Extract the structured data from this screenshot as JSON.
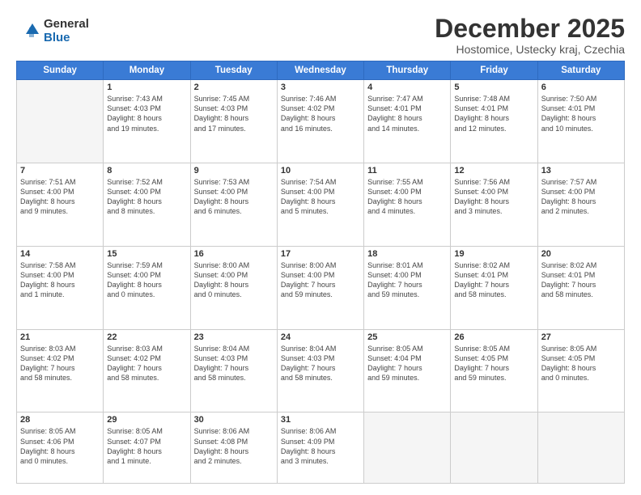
{
  "logo": {
    "general": "General",
    "blue": "Blue"
  },
  "header": {
    "month": "December 2025",
    "location": "Hostomice, Ustecky kraj, Czechia"
  },
  "weekdays": [
    "Sunday",
    "Monday",
    "Tuesday",
    "Wednesday",
    "Thursday",
    "Friday",
    "Saturday"
  ],
  "weeks": [
    [
      {
        "day": "",
        "info": ""
      },
      {
        "day": "1",
        "info": "Sunrise: 7:43 AM\nSunset: 4:03 PM\nDaylight: 8 hours\nand 19 minutes."
      },
      {
        "day": "2",
        "info": "Sunrise: 7:45 AM\nSunset: 4:03 PM\nDaylight: 8 hours\nand 17 minutes."
      },
      {
        "day": "3",
        "info": "Sunrise: 7:46 AM\nSunset: 4:02 PM\nDaylight: 8 hours\nand 16 minutes."
      },
      {
        "day": "4",
        "info": "Sunrise: 7:47 AM\nSunset: 4:01 PM\nDaylight: 8 hours\nand 14 minutes."
      },
      {
        "day": "5",
        "info": "Sunrise: 7:48 AM\nSunset: 4:01 PM\nDaylight: 8 hours\nand 12 minutes."
      },
      {
        "day": "6",
        "info": "Sunrise: 7:50 AM\nSunset: 4:01 PM\nDaylight: 8 hours\nand 10 minutes."
      }
    ],
    [
      {
        "day": "7",
        "info": "Sunrise: 7:51 AM\nSunset: 4:00 PM\nDaylight: 8 hours\nand 9 minutes."
      },
      {
        "day": "8",
        "info": "Sunrise: 7:52 AM\nSunset: 4:00 PM\nDaylight: 8 hours\nand 8 minutes."
      },
      {
        "day": "9",
        "info": "Sunrise: 7:53 AM\nSunset: 4:00 PM\nDaylight: 8 hours\nand 6 minutes."
      },
      {
        "day": "10",
        "info": "Sunrise: 7:54 AM\nSunset: 4:00 PM\nDaylight: 8 hours\nand 5 minutes."
      },
      {
        "day": "11",
        "info": "Sunrise: 7:55 AM\nSunset: 4:00 PM\nDaylight: 8 hours\nand 4 minutes."
      },
      {
        "day": "12",
        "info": "Sunrise: 7:56 AM\nSunset: 4:00 PM\nDaylight: 8 hours\nand 3 minutes."
      },
      {
        "day": "13",
        "info": "Sunrise: 7:57 AM\nSunset: 4:00 PM\nDaylight: 8 hours\nand 2 minutes."
      }
    ],
    [
      {
        "day": "14",
        "info": "Sunrise: 7:58 AM\nSunset: 4:00 PM\nDaylight: 8 hours\nand 1 minute."
      },
      {
        "day": "15",
        "info": "Sunrise: 7:59 AM\nSunset: 4:00 PM\nDaylight: 8 hours\nand 0 minutes."
      },
      {
        "day": "16",
        "info": "Sunrise: 8:00 AM\nSunset: 4:00 PM\nDaylight: 8 hours\nand 0 minutes."
      },
      {
        "day": "17",
        "info": "Sunrise: 8:00 AM\nSunset: 4:00 PM\nDaylight: 7 hours\nand 59 minutes."
      },
      {
        "day": "18",
        "info": "Sunrise: 8:01 AM\nSunset: 4:00 PM\nDaylight: 7 hours\nand 59 minutes."
      },
      {
        "day": "19",
        "info": "Sunrise: 8:02 AM\nSunset: 4:01 PM\nDaylight: 7 hours\nand 58 minutes."
      },
      {
        "day": "20",
        "info": "Sunrise: 8:02 AM\nSunset: 4:01 PM\nDaylight: 7 hours\nand 58 minutes."
      }
    ],
    [
      {
        "day": "21",
        "info": "Sunrise: 8:03 AM\nSunset: 4:02 PM\nDaylight: 7 hours\nand 58 minutes."
      },
      {
        "day": "22",
        "info": "Sunrise: 8:03 AM\nSunset: 4:02 PM\nDaylight: 7 hours\nand 58 minutes."
      },
      {
        "day": "23",
        "info": "Sunrise: 8:04 AM\nSunset: 4:03 PM\nDaylight: 7 hours\nand 58 minutes."
      },
      {
        "day": "24",
        "info": "Sunrise: 8:04 AM\nSunset: 4:03 PM\nDaylight: 7 hours\nand 58 minutes."
      },
      {
        "day": "25",
        "info": "Sunrise: 8:05 AM\nSunset: 4:04 PM\nDaylight: 7 hours\nand 59 minutes."
      },
      {
        "day": "26",
        "info": "Sunrise: 8:05 AM\nSunset: 4:05 PM\nDaylight: 7 hours\nand 59 minutes."
      },
      {
        "day": "27",
        "info": "Sunrise: 8:05 AM\nSunset: 4:05 PM\nDaylight: 8 hours\nand 0 minutes."
      }
    ],
    [
      {
        "day": "28",
        "info": "Sunrise: 8:05 AM\nSunset: 4:06 PM\nDaylight: 8 hours\nand 0 minutes."
      },
      {
        "day": "29",
        "info": "Sunrise: 8:05 AM\nSunset: 4:07 PM\nDaylight: 8 hours\nand 1 minute."
      },
      {
        "day": "30",
        "info": "Sunrise: 8:06 AM\nSunset: 4:08 PM\nDaylight: 8 hours\nand 2 minutes."
      },
      {
        "day": "31",
        "info": "Sunrise: 8:06 AM\nSunset: 4:09 PM\nDaylight: 8 hours\nand 3 minutes."
      },
      {
        "day": "",
        "info": ""
      },
      {
        "day": "",
        "info": ""
      },
      {
        "day": "",
        "info": ""
      }
    ]
  ]
}
